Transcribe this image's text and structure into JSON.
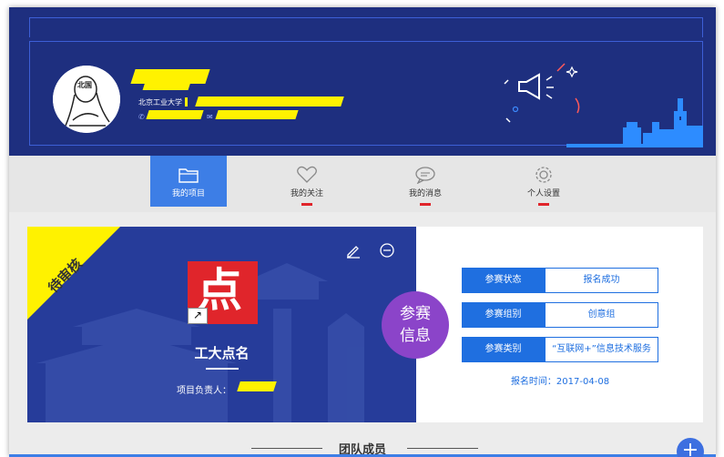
{
  "profile": {
    "school": "北京工业大学",
    "avatar_text": "北国"
  },
  "tabs": [
    {
      "label": "我的项目",
      "active": true
    },
    {
      "label": "我的关注",
      "active": false
    },
    {
      "label": "我的消息",
      "active": false
    },
    {
      "label": "个人设置",
      "active": false
    }
  ],
  "project": {
    "status_ribbon": "待审核",
    "logo_char": "点",
    "name": "工大点名",
    "owner_label": "项目负责人："
  },
  "badge": {
    "line1": "参赛",
    "line2": "信息"
  },
  "info": [
    {
      "key": "参赛状态",
      "value": "报名成功"
    },
    {
      "key": "参赛组别",
      "value": "创意组"
    },
    {
      "key": "参赛类别",
      "value": "“互联网+”信息技术服务"
    }
  ],
  "reg_time": "报名时间：2017-04-08",
  "team_heading": "团队成员",
  "colors": {
    "header_bg": "#1e2f7f",
    "accent_blue": "#1f6fe0",
    "highlight_yellow": "#fff200",
    "badge_purple": "#8b44c9",
    "logo_red": "#e0252b"
  }
}
